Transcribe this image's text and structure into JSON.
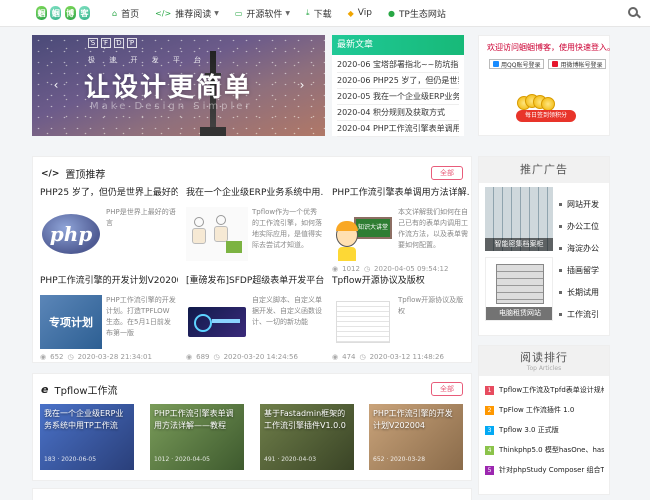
{
  "nav": {
    "logo": [
      "蝈",
      "蝈",
      "博",
      "客"
    ],
    "items": [
      {
        "icon": "home-icon",
        "glyph": "⌂",
        "label": "首页",
        "caret": false
      },
      {
        "icon": "code-icon",
        "glyph": "</>",
        "label": "推荐阅读",
        "caret": true
      },
      {
        "icon": "folder-icon",
        "glyph": "▭",
        "label": "开源软件",
        "caret": true
      },
      {
        "icon": "download-icon",
        "glyph": "⤓",
        "label": "下载",
        "caret": false
      },
      {
        "icon": "diamond-icon",
        "glyph": "◆",
        "label": "Vip",
        "caret": false
      },
      {
        "icon": "tp-icon",
        "glyph": "●",
        "label": "TP生态网站",
        "caret": false
      }
    ]
  },
  "slider": {
    "tag": [
      "S",
      "F",
      "D",
      "P"
    ],
    "sub": "极 速 开 发 平 台",
    "big": "让设计更简单",
    "en": "Make Design Simpler"
  },
  "latest": {
    "title": "最新文章",
    "items": [
      "2020-06 宝塔部署指北~~防坑指南",
      "2020-06 PHP25 岁了，但仍是世界上…",
      "2020-05 我在一个企业级ERP业务系…",
      "2020-04 积分规则及获取方式",
      "2020-04 PHP工作流引擎表单调用方…"
    ]
  },
  "welcome": {
    "text": "欢迎访问蝈蝈博客，使用快速登入。",
    "qq": "用QQ账号登录",
    "weibo": "用微博帐号登录",
    "sign": "每日签到领积分"
  },
  "featured": {
    "title": "置顶推荐",
    "all": "全部",
    "posts": [
      {
        "title": "PHP25 岁了，但仍是世界上最好的…",
        "desc": "PHP是世界上最好的语言",
        "views": "",
        "date": ""
      },
      {
        "title": "我在一个企业级ERP业务系统中用…",
        "desc": "Tpflow作为一个优秀的工作流引擎，如何落地实际应用，是值得实际去尝试才知道。",
        "views": "",
        "date": ""
      },
      {
        "title": "PHP工作流引擎表单调用方法详解…",
        "desc": "本文详解我们如何在自己已有的表单内调用工作流方法，以及表单需要如何配置。",
        "views": "1012",
        "date": "2020-04-05 09:54:12"
      },
      {
        "title": "PHP工作流引擎的开发计划V202004",
        "desc": "PHP工作流引擎的开发计划。打造TPFLOW生态。在5月1日前发布第一版",
        "views": "652",
        "date": "2020-03-28 21:34:01"
      },
      {
        "title": "[重磅发布]SFDP超级表单开发平台…",
        "desc": "自定义脚本、自定义单据开发、自定义函数设计、一切的新功能",
        "views": "689",
        "date": "2020-03-20 14:24:56"
      },
      {
        "title": "Tpflow开源协议及版权",
        "desc": "Tpflow开源协议及版权",
        "views": "474",
        "date": "2020-03-12 11:48:26"
      }
    ],
    "thumb_texts": {
      "teacher": "知识大讲堂",
      "plan": "专项计划",
      "php": "php"
    }
  },
  "workflow": {
    "title": "Tpflow工作流",
    "all": "全部",
    "items": [
      {
        "title": "我在一个企业级ERP业务系统中用TP工作流",
        "views": "183",
        "date": "2020-06-05"
      },
      {
        "title": "PHP工作流引擎表单调用方法详解——教程",
        "views": "1012",
        "date": "2020-04-05"
      },
      {
        "title": "基于Fastadmin框架的工作流引擎插件V1.0.0",
        "views": "491",
        "date": "2020-04-03"
      },
      {
        "title": "PHP工作流引擎的开发计划V202004",
        "views": "652",
        "date": "2020-03-28"
      }
    ]
  },
  "ad": {
    "title": "推广广告",
    "img1": "智能密集档案柜",
    "img2": "电脑租赁网站",
    "links": [
      "网站开发",
      "办公工位",
      "海淀办公",
      "插画留学",
      "长期试用",
      "工作流引"
    ]
  },
  "rank": {
    "title": "阅读排行",
    "sub": "Top Articles",
    "items": [
      {
        "n": "1",
        "color": "#e74c5f",
        "title": "Tpflow工作流及Tpfd表单设计规格…"
      },
      {
        "n": "2",
        "color": "#ff9800",
        "title": "TpFlow 工作流插件 1.0"
      },
      {
        "n": "3",
        "color": "#03a9f4",
        "title": "Tpflow 3.0 正式版"
      },
      {
        "n": "4",
        "color": "#8bc34a",
        "title": "Thinkphp5.0 模型hasOne、hasM…"
      },
      {
        "n": "5",
        "color": "#9c27b0",
        "title": "针对phpStudy Composer 组合Thi…"
      }
    ]
  }
}
